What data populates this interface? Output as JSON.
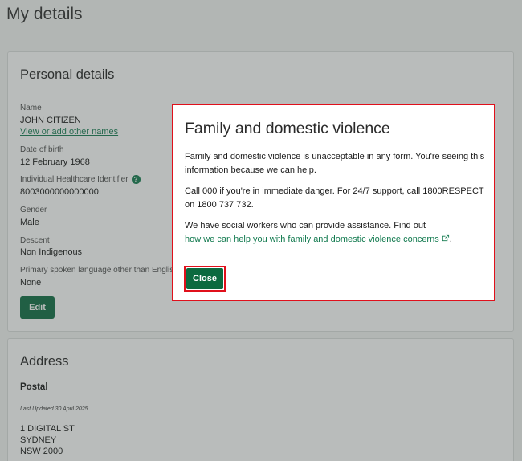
{
  "page": {
    "title": "My details"
  },
  "personal": {
    "heading": "Personal details",
    "name_label": "Name",
    "name_value": "JOHN CITIZEN",
    "other_names_link": "View or add other names",
    "dob_label": "Date of birth",
    "dob_value": "12 February 1968",
    "ihi_label": "Individual Healthcare Identifier",
    "ihi_help": "?",
    "ihi_value": "8003000000000000",
    "gender_label": "Gender",
    "gender_value": "Male",
    "descent_label": "Descent",
    "descent_value": "Non Indigenous",
    "language_label": "Primary spoken language other than English",
    "language_value": "None",
    "edit_label": "Edit"
  },
  "address": {
    "heading": "Address",
    "sub_heading": "Postal",
    "last_updated": "Last Updated 30 April 2025",
    "line1": "1 DIGITAL ST",
    "line2": "SYDNEY",
    "line3": "NSW 2000"
  },
  "modal": {
    "title": "Family and domestic violence",
    "para1": "Family and domestic violence is unacceptable in any form. You're seeing this information because we can help.",
    "para2": "Call 000 if you're in immediate danger. For 24/7 support, call 1800RESPECT on 1800 737 732.",
    "para3_text": "We have social workers who can provide assistance. Find out",
    "para3_link": "how we can help you with family and domestic violence concerns",
    "para3_end": ".",
    "close_label": "Close"
  },
  "colors": {
    "accent": "#0b6a3f",
    "link": "#127a4f",
    "highlight": "#e0101b"
  }
}
